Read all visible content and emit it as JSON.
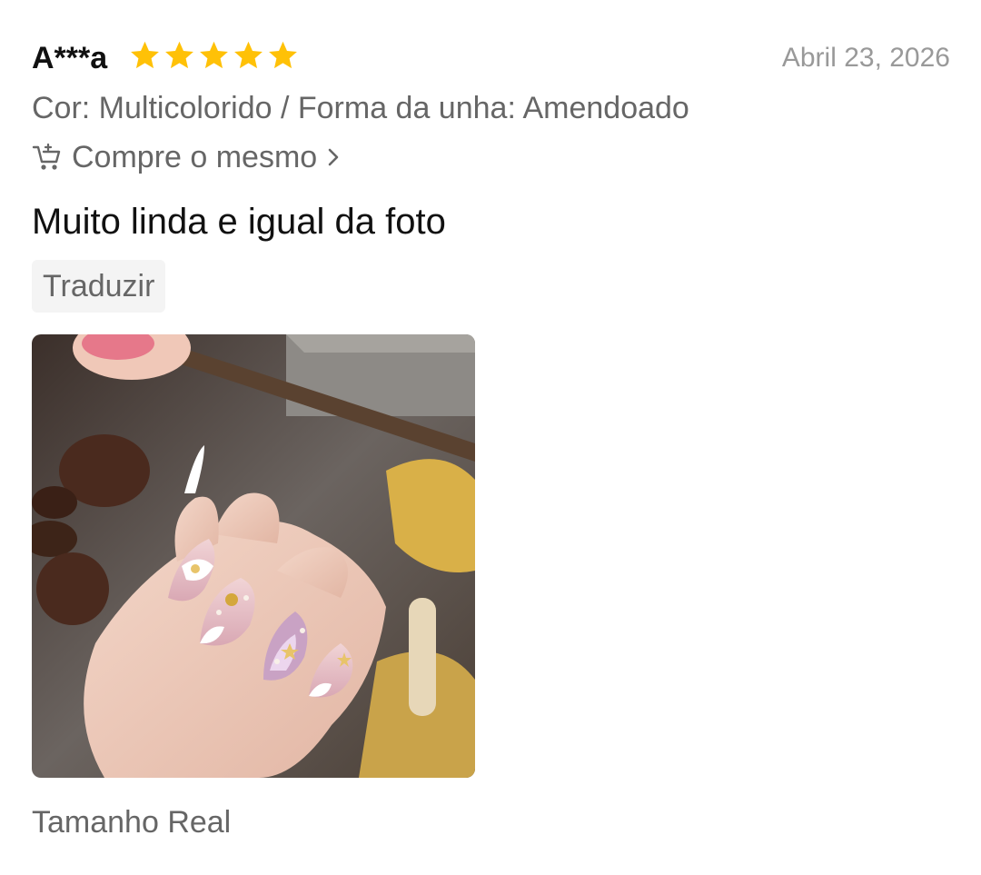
{
  "review": {
    "reviewer": "A***a",
    "rating": 5,
    "date": "Abril 23, 2026",
    "variant": "Cor: Multicolorido / Forma da unha: Amendoado",
    "buy_same_label": "Compre o mesmo",
    "text": "Muito linda e igual da foto",
    "translate_label": "Traduzir",
    "size_label": "Tamanho Real"
  },
  "colors": {
    "star": "#FFC107",
    "reviewer_text": "#111111",
    "meta_text": "#666666",
    "date_text": "#999999",
    "translate_bg": "#F4F4F4"
  },
  "icons": {
    "star": "star-icon",
    "cart": "cart-icon",
    "chevron": "chevron-right-icon"
  }
}
